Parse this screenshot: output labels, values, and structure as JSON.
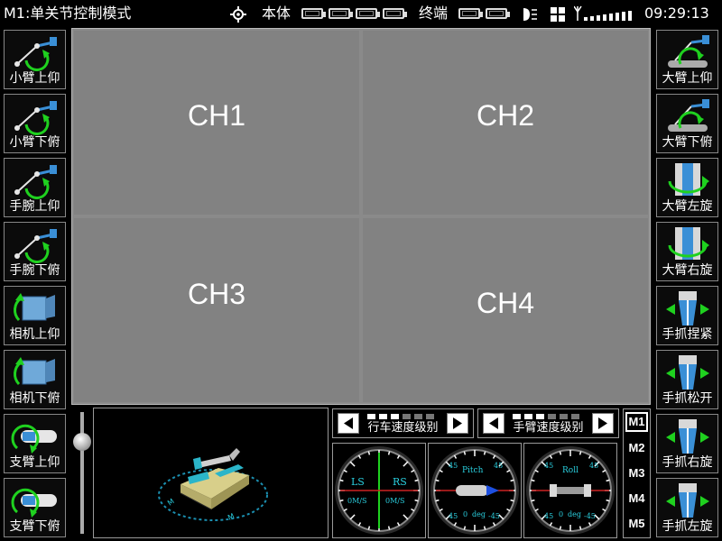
{
  "topbar": {
    "title": "M1:单关节控制模式",
    "body_label": "本体",
    "terminal_label": "终端",
    "time": "09:29:13"
  },
  "left_buttons": [
    {
      "label": "小臂上仰",
      "icon": "arm-raise-icon"
    },
    {
      "label": "小臂下俯",
      "icon": "arm-lower-icon"
    },
    {
      "label": "手腕上仰",
      "icon": "wrist-raise-icon"
    },
    {
      "label": "手腕下俯",
      "icon": "wrist-lower-icon"
    },
    {
      "label": "相机上仰",
      "icon": "camera-raise-icon"
    },
    {
      "label": "相机下俯",
      "icon": "camera-lower-icon"
    },
    {
      "label": "支臂上仰",
      "icon": "support-arm-raise-icon"
    },
    {
      "label": "支臂下俯",
      "icon": "support-arm-lower-icon"
    }
  ],
  "right_buttons": [
    {
      "label": "大臂上仰",
      "icon": "big-arm-raise-icon"
    },
    {
      "label": "大臂下俯",
      "icon": "big-arm-lower-icon"
    },
    {
      "label": "大臂左旋",
      "icon": "big-arm-rotate-left-icon"
    },
    {
      "label": "大臂右旋",
      "icon": "big-arm-rotate-right-icon"
    },
    {
      "label": "手抓捏紧",
      "icon": "gripper-close-icon"
    },
    {
      "label": "手抓松开",
      "icon": "gripper-open-icon"
    },
    {
      "label": "手抓右旋",
      "icon": "gripper-rotate-right-icon"
    },
    {
      "label": "手抓左旋",
      "icon": "gripper-rotate-left-icon"
    }
  ],
  "video": {
    "channels": [
      "CH1",
      "CH2",
      "CH3",
      "CH4"
    ]
  },
  "speed": {
    "drive_label": "行车速度级别",
    "arm_label": "手臂速度级别"
  },
  "gauges": {
    "speed": {
      "ls": "LS",
      "rs": "RS",
      "ls_unit": "0M/S",
      "rs_unit": "0M/S"
    },
    "pitch": {
      "label": "Pitch",
      "value": "0",
      "unit": "deg",
      "tick_pos": "45",
      "tick_neg": "-45"
    },
    "roll": {
      "label": "Roll",
      "value": "0",
      "unit": "deg",
      "tick_pos": "45",
      "tick_neg": "-45"
    }
  },
  "modes": [
    "M1",
    "M2",
    "M3",
    "M4",
    "M5"
  ],
  "colors": {
    "accent_blue": "#3a8fd6",
    "green_arrow": "#1fd11f",
    "cyan_text": "#2ad0e0"
  }
}
